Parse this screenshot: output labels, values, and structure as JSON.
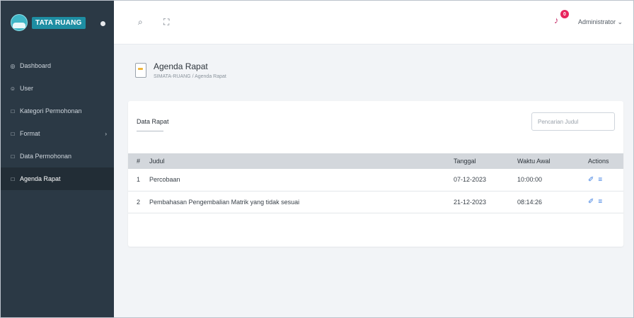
{
  "brand": {
    "name": "TATA RUANG"
  },
  "sidebar": {
    "items": [
      {
        "label": "Dashboard",
        "icon": "◎"
      },
      {
        "label": "User",
        "icon": "☺"
      },
      {
        "label": "Kategori Permohonan",
        "icon": "□"
      },
      {
        "label": "Format",
        "icon": "□",
        "chevron": "›"
      },
      {
        "label": "Data Permohonan",
        "icon": "□"
      },
      {
        "label": "Agenda Rapat",
        "icon": "□"
      }
    ]
  },
  "topbar": {
    "search_icon": "⌕",
    "fullscreen_icon": "⛶",
    "bell_icon": "♪",
    "notification_count": "0",
    "user": "Administrator ⌄"
  },
  "page": {
    "title": "Agenda Rapat",
    "breadcrumb": "SIMATA-RUANG / Agenda Rapat"
  },
  "card": {
    "title": "Data Rapat",
    "search_placeholder": "Pencarian Judul"
  },
  "table": {
    "headers": {
      "no": "#",
      "judul": "Judul",
      "tanggal": "Tanggal",
      "waktu": "Waktu Awal",
      "actions": "Actions"
    },
    "rows": [
      {
        "no": "1",
        "judul": "Percobaan",
        "tanggal": "07-12-2023",
        "waktu": "10:00:00"
      },
      {
        "no": "2",
        "judul": "Pembahasan Pengembalian Matrik yang tidak sesuai",
        "tanggal": "21-12-2023",
        "waktu": "08:14:26"
      }
    ],
    "link_icon": "✐",
    "list_icon": "≡"
  },
  "colors": {
    "sidebar_bg": "#2b3945",
    "sidebar_active": "#222d36",
    "brand_accent": "#1e8ea3",
    "notification": "#e8255d",
    "action_icon": "#3b7de0"
  }
}
